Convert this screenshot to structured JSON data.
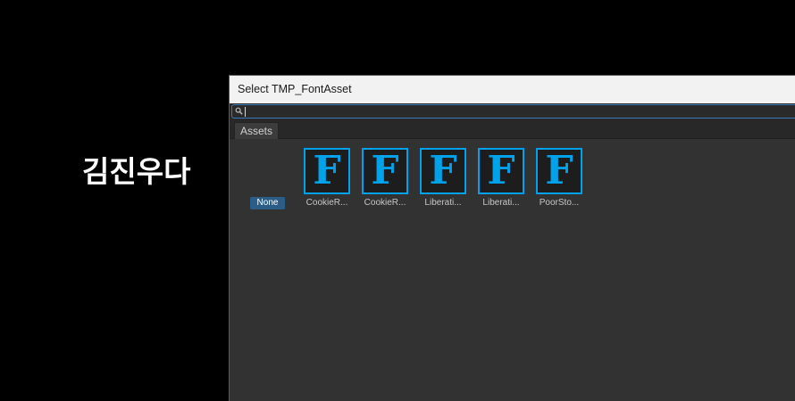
{
  "watermark": {
    "text": "김진우다"
  },
  "dialog": {
    "title": "Select TMP_FontAsset",
    "search": {
      "value": "",
      "placeholder": ""
    },
    "tabs": [
      {
        "label": "Assets"
      }
    ],
    "none_item": {
      "label": "None"
    },
    "assets": [
      {
        "label": "CookieR...",
        "glyph": "F",
        "icon": "font-asset-icon"
      },
      {
        "label": "CookieR...",
        "glyph": "F",
        "icon": "font-asset-icon"
      },
      {
        "label": "Liberati...",
        "glyph": "F",
        "icon": "font-asset-icon"
      },
      {
        "label": "Liberati...",
        "glyph": "F",
        "icon": "font-asset-icon"
      },
      {
        "label": "PoorSto...",
        "glyph": "F",
        "icon": "font-asset-icon"
      }
    ]
  },
  "colors": {
    "background": "#000000",
    "panel": "#323232",
    "accent": "#00a2ea",
    "selection": "#2c5d87",
    "focus_border": "#3a79bb"
  }
}
